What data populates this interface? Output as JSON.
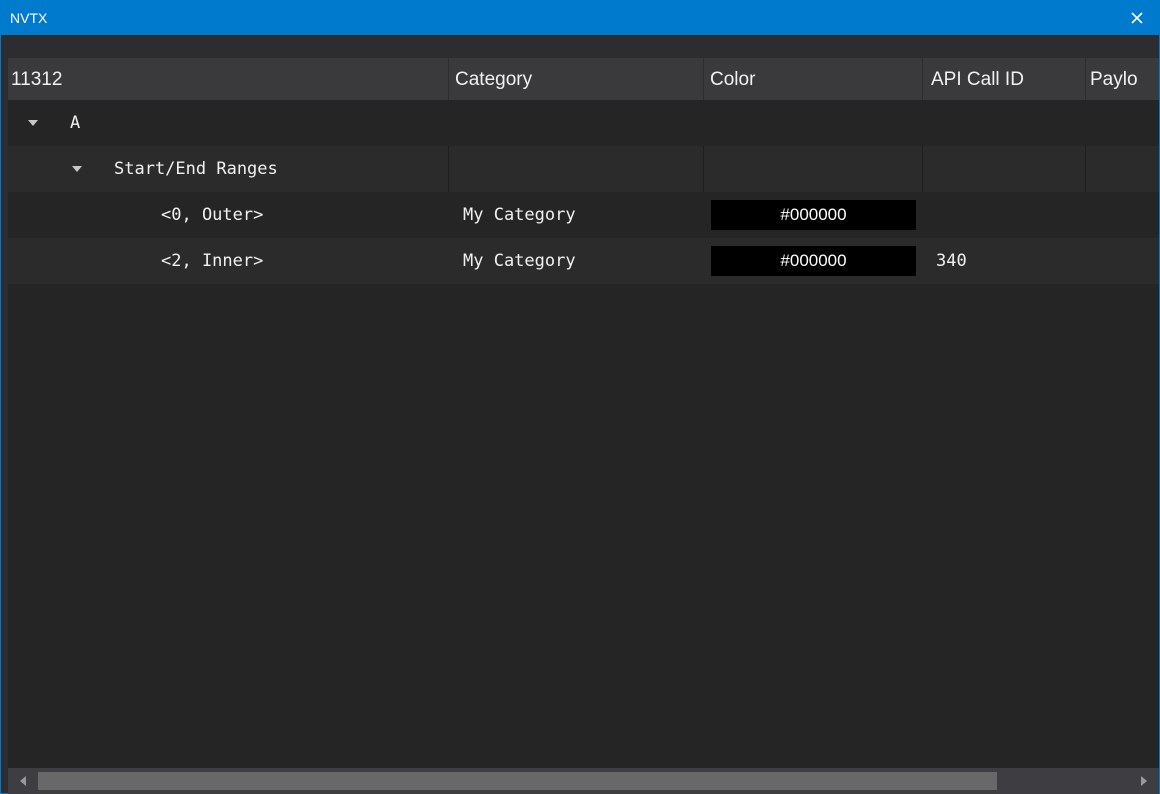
{
  "window": {
    "title": "NVTX"
  },
  "columns": [
    {
      "label": "11312"
    },
    {
      "label": "Category"
    },
    {
      "label": "Color"
    },
    {
      "label": "API Call ID"
    },
    {
      "label": "Paylo"
    }
  ],
  "tree": {
    "domain": {
      "label": "A"
    },
    "group": {
      "label": "Start/End Ranges"
    },
    "rows": [
      {
        "name": "<0, Outer>",
        "category": "My Category",
        "color": "#000000",
        "api_call_id": ""
      },
      {
        "name": "<2, Inner>",
        "category": "My Category",
        "color": "#000000",
        "api_call_id": "340"
      }
    ]
  },
  "colors": {
    "titlebar": "#007acc",
    "background": "#252526",
    "header": "#3a3a3d",
    "text": "#f1f1f1"
  },
  "icons": {
    "close": "close-icon",
    "expand": "triangle-down-icon",
    "scroll_left": "arrow-left-icon",
    "scroll_right": "arrow-right-icon"
  }
}
